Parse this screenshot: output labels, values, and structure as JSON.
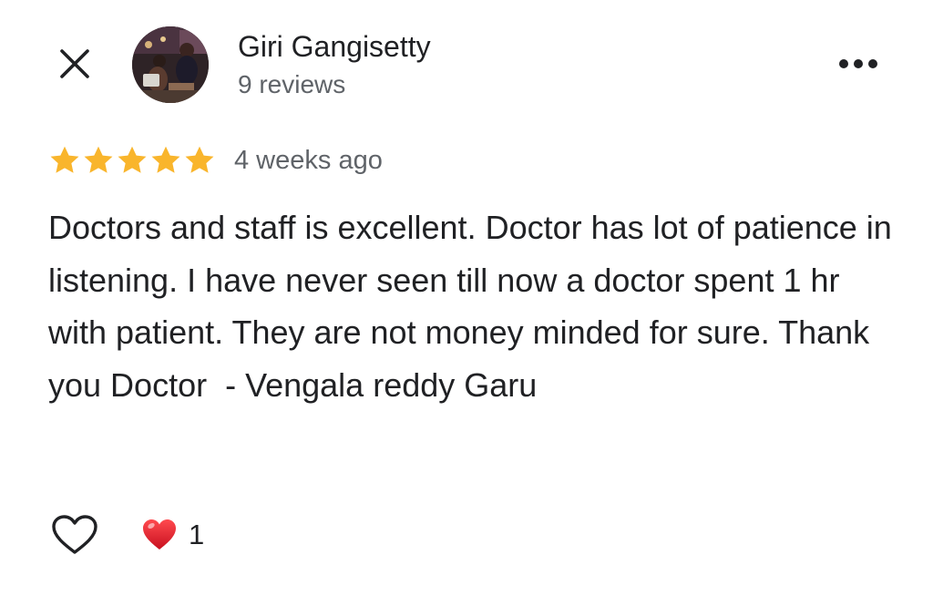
{
  "reviewer": {
    "name": "Giri Gangisetty",
    "reviews_count": "9 reviews",
    "avatar_icon": "profile-photo"
  },
  "review": {
    "rating": 5,
    "rating_max": 5,
    "date": "4 weeks ago",
    "text": "Doctors and staff is excellent. Doctor has lot of patience in listening. I have never seen till now a doctor spent 1 hr with patient. They are not money minded for sure. Thank you Doctor  - Vengala reddy Garu"
  },
  "actions": {
    "close_icon": "close-icon",
    "more_icon": "more-options-icon",
    "like_icon": "heart-outline-icon",
    "reaction_icon": "red-heart-icon",
    "reaction_count": "1"
  },
  "colors": {
    "star": "#F9B52C",
    "text_primary": "#202124",
    "text_secondary": "#5F6368",
    "heart_red": "#E0242E"
  }
}
